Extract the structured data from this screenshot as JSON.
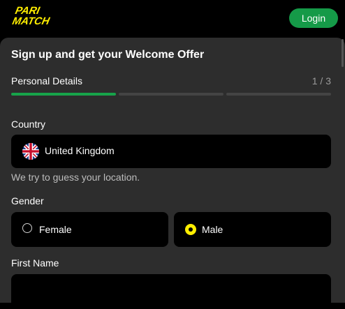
{
  "header": {
    "logo_line1": "PARI",
    "logo_line2": "MATCH",
    "login_label": "Login"
  },
  "form": {
    "title": "Sign up and get your Welcome Offer",
    "step_label": "Personal Details",
    "step_counter": "1 / 3",
    "progress_fraction": 0.333,
    "country": {
      "label": "Country",
      "value": "United Kingdom",
      "hint": "We try to guess your location."
    },
    "gender": {
      "label": "Gender",
      "options": [
        {
          "label": "Female",
          "selected": false
        },
        {
          "label": "Male",
          "selected": true
        }
      ]
    },
    "first_name": {
      "label": "First Name",
      "value": ""
    }
  },
  "colors": {
    "accent_green": "#159a48",
    "radio_selected": "#ffee00",
    "logo_yellow": "#ffee00",
    "panel_bg": "#2d2d2d"
  }
}
